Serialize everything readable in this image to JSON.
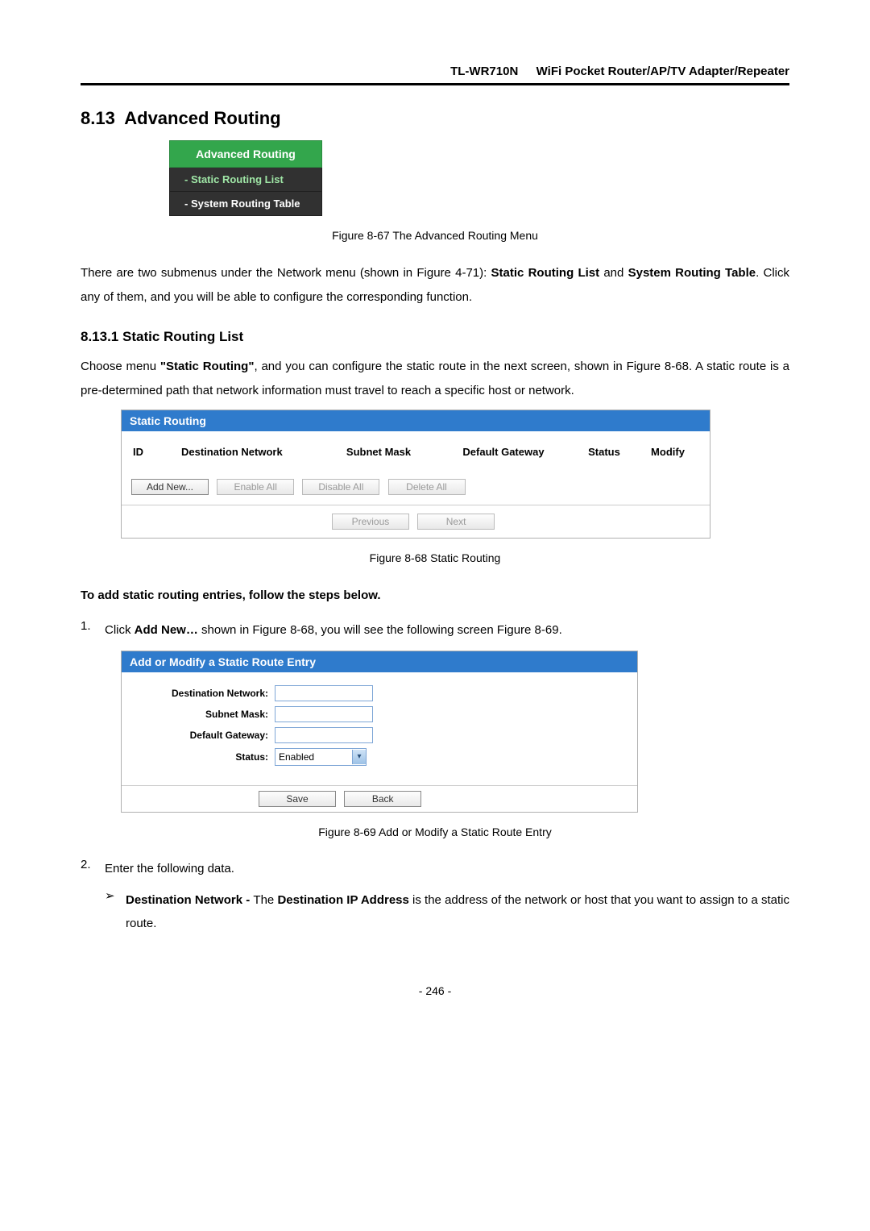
{
  "header": {
    "model": "TL-WR710N",
    "product": "WiFi  Pocket  Router/AP/TV  Adapter/Repeater"
  },
  "section": {
    "number": "8.13",
    "title": "Advanced Routing"
  },
  "menu": {
    "header": "Advanced Routing",
    "items": [
      {
        "label": "- Static Routing List",
        "active": true
      },
      {
        "label": "- System Routing Table",
        "active": false
      }
    ]
  },
  "figure_menu": "Figure 8-67    The Advanced Routing Menu",
  "para_intro_1": "There are two submenus under the Network menu (shown in Figure 4-71): ",
  "para_intro_bold": "Static Routing List",
  "para_intro_mid": " and ",
  "para_intro_bold2": "System Routing Table",
  "para_intro_end": ". Click any of them, and you will be able to configure the corresponding function.",
  "subsection": {
    "number": "8.13.1",
    "title": "Static Routing List"
  },
  "para_srl_1": "Choose menu ",
  "para_srl_bold": "\"Static Routing\"",
  "para_srl_2": ", and you can configure the static route in the next screen, shown in Figure 8-68. A static route is a pre-determined path that network information must travel to reach a specific host or network.",
  "static_panel": {
    "title": "Static Routing",
    "cols": {
      "id": "ID",
      "net": "Destination Network",
      "mask": "Subnet Mask",
      "gw": "Default Gateway",
      "status": "Status",
      "modify": "Modify"
    },
    "buttons": {
      "add": "Add New...",
      "enable": "Enable All",
      "disable": "Disable All",
      "delete": "Delete All",
      "prev": "Previous",
      "next": "Next"
    }
  },
  "figure_static": "Figure 8-68    Static Routing",
  "add_instr": "To add static routing entries, follow the steps below.",
  "step1_pre": "Click ",
  "step1_bold": "Add New…",
  "step1_post": " shown in Figure 8-68, you will see the following screen Figure 8-69.",
  "modify_panel": {
    "title": "Add or Modify a Static Route Entry",
    "labels": {
      "net": "Destination Network:",
      "mask": "Subnet Mask:",
      "gw": "Default Gateway:",
      "status": "Status:"
    },
    "status_value": "Enabled",
    "buttons": {
      "save": "Save",
      "back": "Back"
    }
  },
  "figure_modify": "Figure 8-69    Add or Modify a Static Route Entry",
  "step2": "Enter the following data.",
  "sub_bullet_bold1": "Destination Network - ",
  "sub_bullet_text1a": "The ",
  "sub_bullet_bold1b": "Destination IP Address",
  "sub_bullet_text1b": " is the address of the network or host that you want to assign to a static route.",
  "page_num": "- 246 -",
  "ol_nums": {
    "n1": "1.",
    "n2": "2."
  },
  "bullet_glyph": "➢"
}
